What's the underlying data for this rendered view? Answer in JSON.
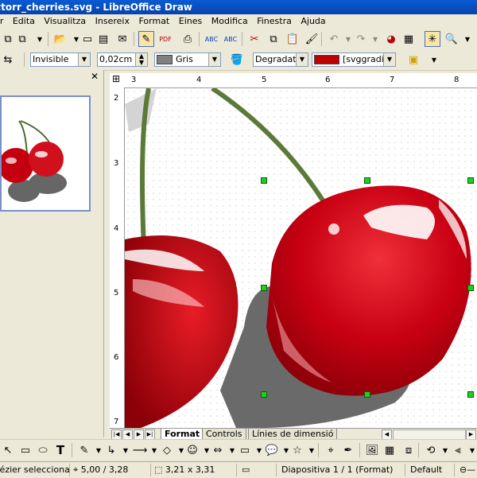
{
  "window": {
    "title": "ctorr_cherries.svg - LibreOffice Draw"
  },
  "menu": [
    "Fitxer",
    "Edita",
    "Visualitza",
    "Insereix",
    "Format",
    "Eines",
    "Modifica",
    "Finestra",
    "Ajuda"
  ],
  "line_props": {
    "line_style": "Invisible",
    "line_width": "0,02cm",
    "line_color": "Gris",
    "line_color_hex": "#808080",
    "area_style": "Degradat",
    "area_value": "[svggradien",
    "area_color_hex": "#c00000"
  },
  "ruler": {
    "h_ticks": [
      "3",
      "4",
      "5",
      "6",
      "7",
      "8"
    ],
    "v_ticks": [
      "2",
      "3",
      "4",
      "5",
      "6",
      "7"
    ]
  },
  "tabs": [
    "Format",
    "Controls",
    "Línies de dimensió"
  ],
  "status": {
    "selection": "Bézier seleccionat",
    "position": "5,00 / 3,28",
    "size": "3,21 x 3,31",
    "slide": "Diapositiva 1 / 1 (Format)",
    "layout": "Default"
  }
}
